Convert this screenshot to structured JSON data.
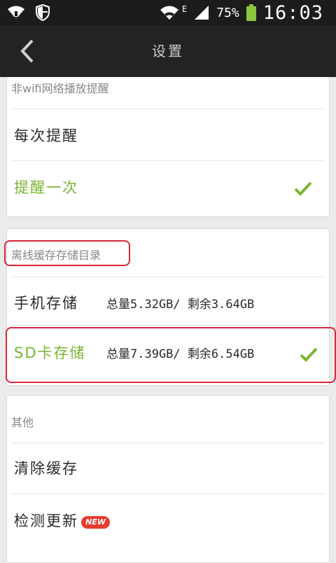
{
  "status_bar": {
    "signal_label": "E",
    "battery_text": "75%",
    "time": "16:03",
    "icons": [
      "wifi-icon",
      "shield-icon",
      "wifi-icon",
      "cell-signal-icon",
      "battery-icon"
    ]
  },
  "header": {
    "title": "设置",
    "back_icon": "chevron-left-icon"
  },
  "sections": {
    "network": {
      "title": "非wifi网络播放提醒",
      "items": [
        {
          "label": "每次提醒",
          "selected": false
        },
        {
          "label": "提醒一次",
          "selected": true
        }
      ]
    },
    "storage": {
      "title": "离线缓存存储目录",
      "items": [
        {
          "label": "手机存储",
          "info": "总量5.32GB/ 剩余3.64GB",
          "selected": false
        },
        {
          "label": "SD卡存储",
          "info": "总量7.39GB/ 剩余6.54GB",
          "selected": true
        }
      ]
    },
    "other": {
      "title": "其他",
      "items": [
        {
          "label": "清除缓存"
        },
        {
          "label": "检测更新",
          "badge": "NEW"
        }
      ]
    }
  },
  "colors": {
    "accent_green": "#7ab530",
    "highlight_red": "#d9263b",
    "badge_red": "#e83b2f",
    "topbar": "#232323",
    "statusbar": "#1c1c1c"
  }
}
